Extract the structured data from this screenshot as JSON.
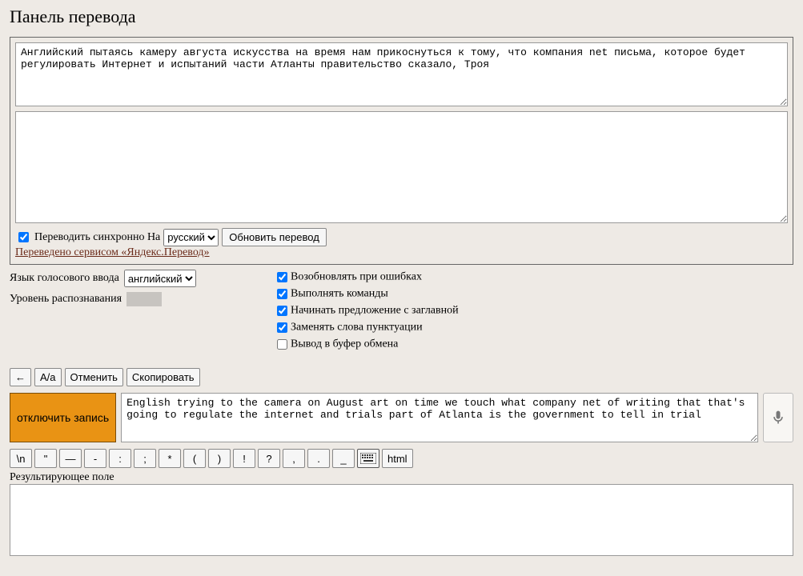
{
  "title": "Панель перевода",
  "input_text": "Английский пытаясь камеру августа искусства на время нам прикоснуться к тому, что компания net письма, которое будет регулировать Интернет и испытаний части Атланты правительство сказало, Троя",
  "sync": {
    "label": "Переводить синхронно На",
    "lang": "русский",
    "update_btn": "Обновить перевод"
  },
  "yandex_link": "Переведено сервисом «Яндекс.Перевод»",
  "voice": {
    "lang_label": "Язык голосового ввода",
    "lang": "английский",
    "level_label": "Уровень распознавания"
  },
  "checks": {
    "resume": "Возобновлять при ошибках",
    "commands": "Выполнять команды",
    "capitalize": "Начинать предложение с заглавной",
    "punct": "Заменять слова пунктуации",
    "clipboard": "Вывод в буфер обмена"
  },
  "toolbar": {
    "back": "←",
    "case": "А/а",
    "undo": "Отменить",
    "copy": "Скопировать"
  },
  "record_btn": "отключить запись",
  "record_text": "English trying to the camera on August art on time we touch what company net of writing that that's going to regulate the internet and trials part of Atlanta is the government to tell in trial",
  "symbols": [
    "\\n",
    "\"",
    "—",
    "-",
    ":",
    ";",
    "*",
    "(",
    ")",
    "!",
    "?",
    ",",
    ".",
    "_"
  ],
  "html_btn": "html",
  "result_label": "Результирующее поле"
}
